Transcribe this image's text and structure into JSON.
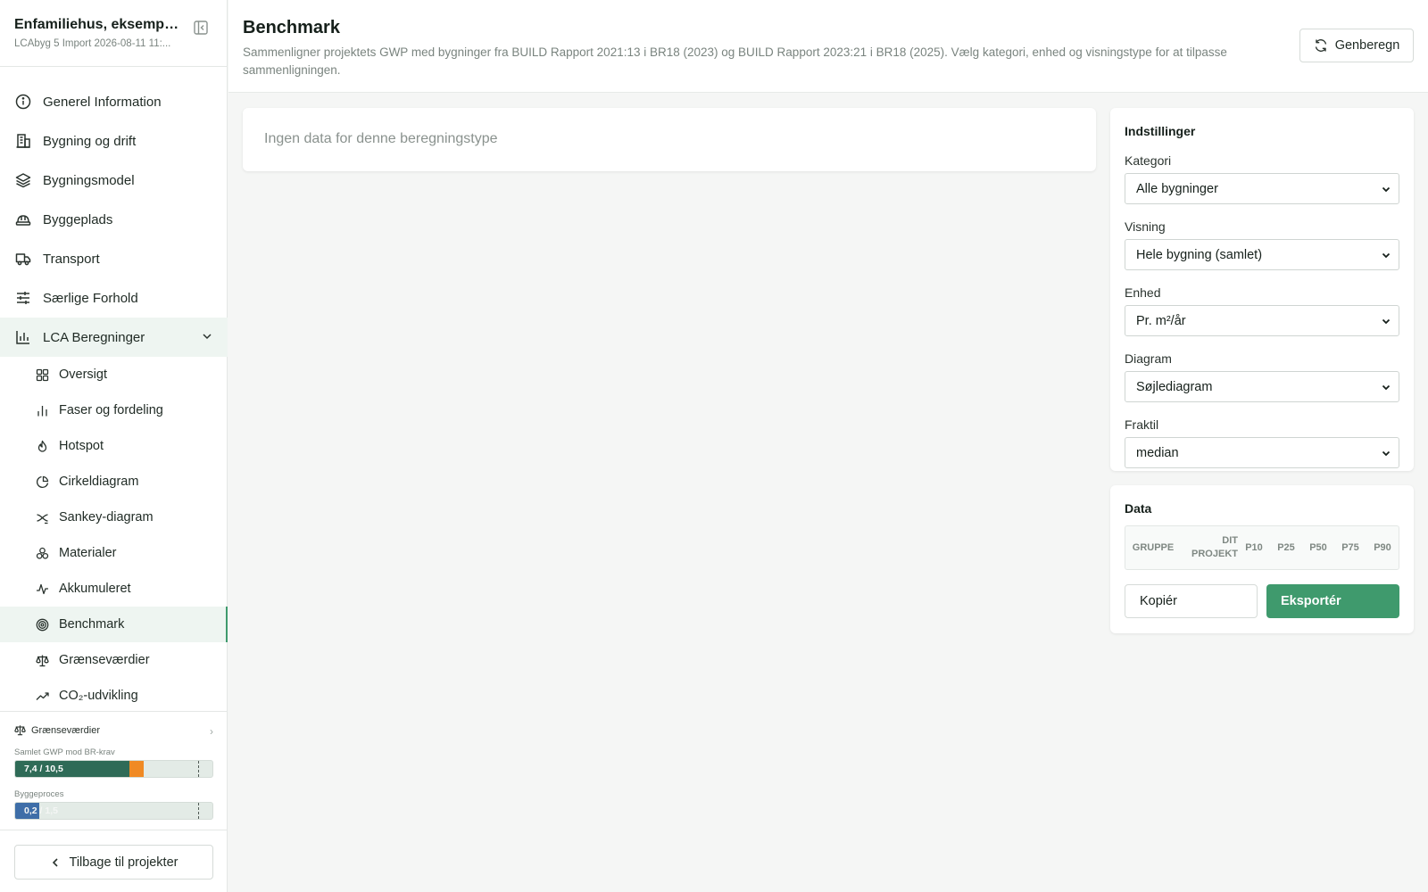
{
  "project": {
    "title": "Enfamiliehus, eksempel...",
    "subtitle": "LCAbyg 5 Import 2026-08-11 11:..."
  },
  "nav": {
    "items": [
      {
        "label": "Generel Information",
        "icon": "info-icon"
      },
      {
        "label": "Bygning og drift",
        "icon": "building-icon"
      },
      {
        "label": "Bygningsmodel",
        "icon": "layers-icon"
      },
      {
        "label": "Byggeplads",
        "icon": "hardhat-icon"
      },
      {
        "label": "Transport",
        "icon": "truck-icon"
      },
      {
        "label": "Særlige Forhold",
        "icon": "sliders-icon"
      }
    ],
    "group": {
      "label": "LCA Beregninger",
      "icon": "bar-chart-icon",
      "expanded": true
    },
    "sub_items": [
      {
        "label": "Oversigt",
        "icon": "grid-icon"
      },
      {
        "label": "Faser og fordeling",
        "icon": "bar-chart-small-icon"
      },
      {
        "label": "Hotspot",
        "icon": "flame-icon"
      },
      {
        "label": "Cirkeldiagram",
        "icon": "pie-icon"
      },
      {
        "label": "Sankey-diagram",
        "icon": "sankey-icon"
      },
      {
        "label": "Materialer",
        "icon": "materials-icon"
      },
      {
        "label": "Akkumuleret",
        "icon": "activity-icon"
      },
      {
        "label": "Benchmark",
        "icon": "target-icon",
        "active": true
      },
      {
        "label": "Grænseværdier",
        "icon": "scale-icon"
      },
      {
        "label": "CO₂-udvikling",
        "icon": "trend-icon"
      }
    ]
  },
  "limits": {
    "heading": "Grænseværdier",
    "bars": [
      {
        "label": "Samlet GWP mod BR-krav",
        "text": "7,4 / 10,5",
        "value": 7.4,
        "max": 10.5
      },
      {
        "label": "Byggeproces",
        "text": "0,2 / 1,5",
        "value": 0.2,
        "max": 1.5
      }
    ]
  },
  "back_label": "Tilbage til projekter",
  "header": {
    "title": "Benchmark",
    "description": "Sammenligner projektets GWP med bygninger fra BUILD Rapport 2021:13 i BR18 (2023) og BUILD Rapport 2023:21 i BR18 (2025). Vælg kategori, enhed og visningstype for at tilpasse sammenligningen.",
    "regen_label": "Genberegn"
  },
  "empty_message": "Ingen data for denne beregningstype",
  "settings": {
    "title": "Indstillinger",
    "fields": [
      {
        "label": "Kategori",
        "value": "Alle bygninger"
      },
      {
        "label": "Visning",
        "value": "Hele bygning (samlet)"
      },
      {
        "label": "Enhed",
        "value": "Pr. m²/år"
      },
      {
        "label": "Diagram",
        "value": "Søjlediagram"
      },
      {
        "label": "Fraktil",
        "value": "median"
      }
    ]
  },
  "data_panel": {
    "title": "Data",
    "columns": [
      "GRUPPE",
      "DIT PROJEKT",
      "P10",
      "P25",
      "P50",
      "P75",
      "P90"
    ],
    "copy_label": "Kopiér",
    "export_label": "Eksportér"
  },
  "colors": {
    "accent": "#3f9a6d",
    "gwp_bar": "#2f6b57",
    "gwp_overflow": "#f08a24",
    "process_bar": "#3e6ea8"
  }
}
